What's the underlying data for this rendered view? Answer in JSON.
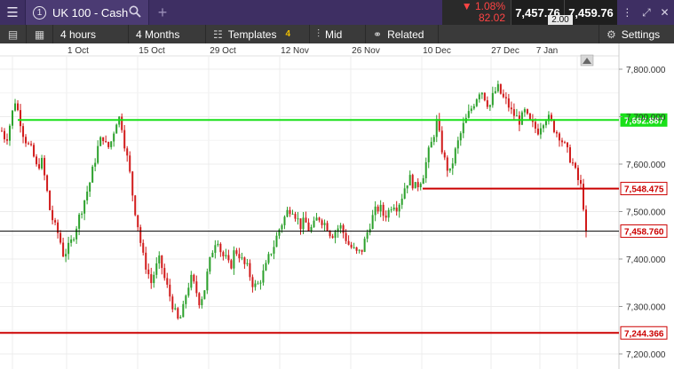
{
  "topbar": {
    "tab_number": "1",
    "instrument": "UK 100 - Cash",
    "change_pct": "▼ 1.08%",
    "change_pts": "82.02",
    "bid": "7,457.76",
    "ask": "7,459.76",
    "spread": "2.00"
  },
  "toolbar": {
    "interval": "4 hours",
    "range": "4 Months",
    "templates": "Templates",
    "templates_count": "4",
    "price_type": "Mid",
    "related": "Related",
    "settings": "Settings"
  },
  "colors": {
    "up": "#2ba02b",
    "down": "#d11a1a",
    "green_line": "#19e019",
    "red_line": "#cc0000",
    "current_line": "#000000"
  },
  "chart_data": {
    "type": "candlestick",
    "title": "",
    "x_tick_labels": [
      "1 Oct",
      "15 Oct",
      "29 Oct",
      "12 Nov",
      "26 Nov",
      "10 Dec",
      "27 Dec",
      "7 Jan"
    ],
    "y_tick_labels": [
      "7,800.000",
      "7,700.000",
      "7,600.000",
      "7,500.000",
      "7,400.000",
      "7,300.000",
      "7,200.000"
    ],
    "y_ticks": [
      7800,
      7700,
      7600,
      7500,
      7400,
      7300,
      7200
    ],
    "ylim": [
      7186,
      7850
    ],
    "grid": true,
    "horizontal_lines": [
      {
        "value": 7692.887,
        "label": "7,692.887",
        "style": "green"
      },
      {
        "value": 7548.475,
        "label": "7,548.475",
        "style": "red"
      },
      {
        "value": 7458.76,
        "label": "7,458.760",
        "style": "current"
      },
      {
        "value": 7244.366,
        "label": "7,244.366",
        "style": "red"
      }
    ],
    "series": [
      {
        "name": "",
        "close_path": [
          7670,
          7650,
          7690,
          7735,
          7700,
          7660,
          7640,
          7625,
          7590,
          7610,
          7560,
          7500,
          7470,
          7450,
          7410,
          7420,
          7440,
          7470,
          7500,
          7530,
          7560,
          7600,
          7640,
          7660,
          7630,
          7650,
          7690,
          7700,
          7640,
          7590,
          7520,
          7470,
          7410,
          7380,
          7350,
          7380,
          7400,
          7360,
          7330,
          7300,
          7270,
          7280,
          7330,
          7360,
          7340,
          7310,
          7330,
          7380,
          7420,
          7450,
          7410,
          7400,
          7380,
          7420,
          7410,
          7390,
          7380,
          7350,
          7340,
          7360,
          7380,
          7410,
          7430,
          7460,
          7480,
          7500,
          7510,
          7490,
          7470,
          7480,
          7460,
          7470,
          7490,
          7480,
          7470,
          7450,
          7460,
          7470,
          7450,
          7430,
          7420,
          7410,
          7420,
          7450,
          7480,
          7500,
          7510,
          7490,
          7500,
          7520,
          7510,
          7530,
          7560,
          7570,
          7550,
          7560,
          7580,
          7620,
          7650,
          7690,
          7640,
          7600,
          7580,
          7620,
          7650,
          7680,
          7700,
          7720,
          7740,
          7760,
          7740,
          7720,
          7750,
          7760,
          7740,
          7730,
          7710,
          7700,
          7690,
          7710,
          7690,
          7680,
          7670,
          7690,
          7700,
          7690,
          7670,
          7660,
          7640,
          7620,
          7600,
          7570,
          7548,
          7459
        ]
      }
    ]
  }
}
